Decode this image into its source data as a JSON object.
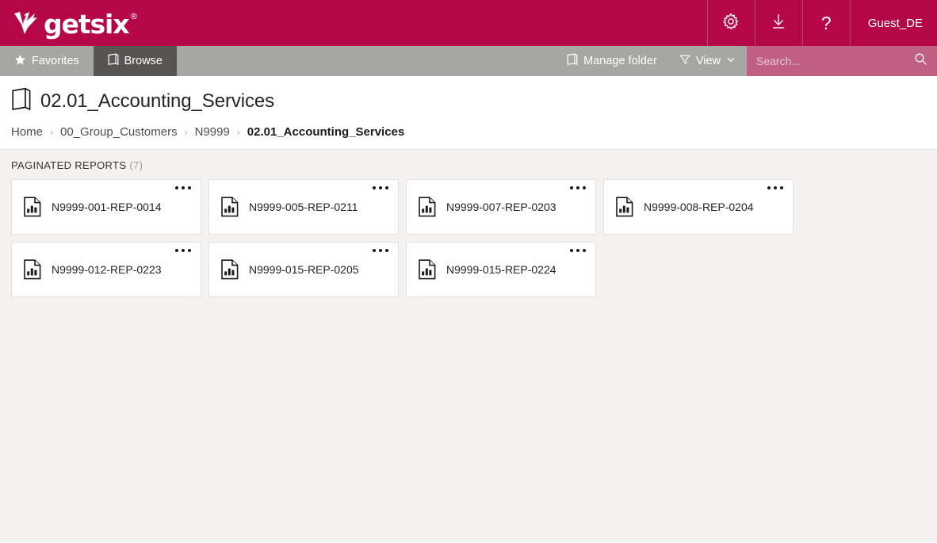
{
  "header": {
    "brand_name": "getsix",
    "brand_registered": "®",
    "brand_logo_icon": "getsix-arrow-logo",
    "settings_icon": "gear-icon",
    "download_icon": "download-icon",
    "help_icon": "question-mark-icon",
    "user_label": "Guest_DE",
    "accent_color": "#b5064a"
  },
  "toolbar": {
    "favorites_label": "Favorites",
    "favorites_icon": "star-icon",
    "browse_label": "Browse",
    "browse_icon": "folder-icon",
    "manage_folder_label": "Manage folder",
    "manage_folder_icon": "folder-icon",
    "view_label": "View",
    "view_icon": "filter-funnel-icon",
    "view_chevron_icon": "chevron-down-icon",
    "search_placeholder": "Search...",
    "search_value": "",
    "search_icon": "search-icon",
    "bar_color": "#a6a6a3",
    "active_tab_color": "#575553",
    "search_bg_color": "#bf5f81"
  },
  "page": {
    "title": "02.01_Accounting_Services",
    "title_icon": "folder-icon",
    "breadcrumb": [
      {
        "label": "Home",
        "current": false
      },
      {
        "label": "00_Group_Customers",
        "current": false
      },
      {
        "label": "N9999",
        "current": false
      },
      {
        "label": "02.01_Accounting_Services",
        "current": true
      }
    ],
    "breadcrumb_separator": "›"
  },
  "content": {
    "section_title": "PAGINATED REPORTS",
    "section_count": "(7)",
    "background_color": "#f3f2f1",
    "item_icon": "paginated-report-icon",
    "item_menu_icon": "more-options-icon",
    "items": [
      {
        "label": "N9999-001-REP-0014"
      },
      {
        "label": "N9999-005-REP-0211"
      },
      {
        "label": "N9999-007-REP-0203"
      },
      {
        "label": "N9999-008-REP-0204"
      },
      {
        "label": "N9999-012-REP-0223"
      },
      {
        "label": "N9999-015-REP-0205"
      },
      {
        "label": "N9999-015-REP-0224"
      }
    ]
  }
}
